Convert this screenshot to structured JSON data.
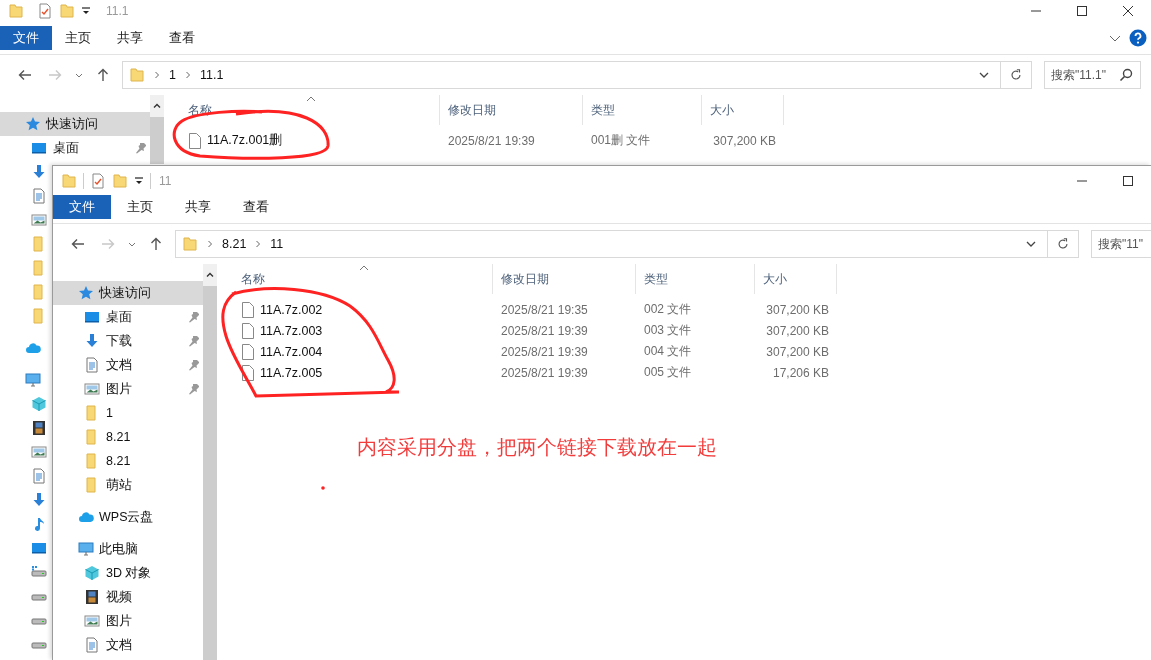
{
  "windows": [
    {
      "title": "11.1",
      "controls": [
        {
          "kind": "minimize"
        },
        {
          "kind": "maximize"
        },
        {
          "kind": "close"
        }
      ],
      "ribbon_tabs": [
        {
          "label": "文件",
          "selected": true
        },
        {
          "label": "主页",
          "selected": false
        },
        {
          "label": "共享",
          "selected": false
        },
        {
          "label": "查看",
          "selected": false
        }
      ],
      "ribbon_help": true,
      "forward_disabled": true,
      "address": [
        "1",
        "11.1"
      ],
      "search": {
        "placeholder": "搜索\"11.1\""
      },
      "sidebar": {
        "items": [
          {
            "kind": "quick",
            "label": "快速访问",
            "selected": true,
            "children": [
              {
                "kind": "desktop",
                "label": "桌面",
                "pinned": true,
                "selected": false
              },
              {
                "kind": "download",
                "selected": false
              },
              {
                "kind": "document",
                "selected": false
              },
              {
                "kind": "picture",
                "selected": false
              },
              {
                "kind": "folder",
                "selected": false
              },
              {
                "kind": "folder",
                "selected": false
              },
              {
                "kind": "folder",
                "selected": false
              },
              {
                "kind": "folder",
                "selected": false
              }
            ]
          },
          {
            "kind": "cloud",
            "selected": false
          },
          {
            "kind": "pc",
            "selected": false,
            "children": [
              {
                "kind": "cube",
                "selected": false
              },
              {
                "kind": "video",
                "selected": false
              },
              {
                "kind": "picture",
                "selected": false
              },
              {
                "kind": "document",
                "selected": false
              },
              {
                "kind": "download",
                "selected": false
              },
              {
                "kind": "music",
                "selected": false
              },
              {
                "kind": "desktop",
                "selected": false
              },
              {
                "kind": "drive-win",
                "selected": false
              },
              {
                "kind": "drive",
                "selected": false
              },
              {
                "kind": "drive",
                "selected": false
              },
              {
                "kind": "drive",
                "selected": false
              }
            ]
          }
        ]
      },
      "columns": [
        "名称",
        "修改日期",
        "类型",
        "大小"
      ],
      "rows": [
        {
          "name": "11A.7z.001删",
          "date": "2025/8/21 19:39",
          "type": "001删 文件",
          "size": "307,200 KB"
        }
      ]
    },
    {
      "title": "11",
      "controls": [
        {
          "kind": "minimize"
        },
        {
          "kind": "maximize"
        }
      ],
      "ribbon_tabs": [
        {
          "label": "文件",
          "selected": true
        },
        {
          "label": "主页",
          "selected": false
        },
        {
          "label": "共享",
          "selected": false
        },
        {
          "label": "查看",
          "selected": false
        }
      ],
      "forward_disabled": true,
      "address": [
        "8.21",
        "11"
      ],
      "search": {
        "placeholder": "搜索\"11\""
      },
      "sidebar": {
        "items": [
          {
            "kind": "quick",
            "label": "快速访问",
            "selected": true,
            "children": [
              {
                "kind": "desktop",
                "label": "桌面",
                "pinned": true,
                "selected": false
              },
              {
                "kind": "download",
                "label": "下载",
                "pinned": true,
                "selected": false
              },
              {
                "kind": "document",
                "label": "文档",
                "pinned": true,
                "selected": false
              },
              {
                "kind": "picture",
                "label": "图片",
                "pinned": true,
                "selected": false
              },
              {
                "kind": "folder",
                "label": "1",
                "pinned": false,
                "selected": false
              },
              {
                "kind": "folder",
                "label": "8.21",
                "pinned": false,
                "selected": false
              },
              {
                "kind": "folder",
                "label": "8.21",
                "pinned": false,
                "selected": false
              },
              {
                "kind": "folder",
                "label": "萌站",
                "pinned": false,
                "selected": false
              }
            ]
          },
          {
            "kind": "cloud",
            "label": "WPS云盘",
            "selected": false
          },
          {
            "kind": "pc",
            "label": "此电脑",
            "selected": false,
            "children": [
              {
                "kind": "cube",
                "label": "3D 对象",
                "selected": false
              },
              {
                "kind": "video",
                "label": "视频",
                "selected": false
              },
              {
                "kind": "picture",
                "label": "图片",
                "selected": false
              },
              {
                "kind": "document",
                "label": "文档",
                "selected": false
              }
            ]
          }
        ]
      },
      "columns": [
        "名称",
        "修改日期",
        "类型",
        "大小"
      ],
      "rows": [
        {
          "name": "11A.7z.002",
          "date": "2025/8/21 19:35",
          "type": "002 文件",
          "size": "307,200 KB"
        },
        {
          "name": "11A.7z.003",
          "date": "2025/8/21 19:39",
          "type": "003 文件",
          "size": "307,200 KB"
        },
        {
          "name": "11A.7z.004",
          "date": "2025/8/21 19:39",
          "type": "004 文件",
          "size": "307,200 KB"
        },
        {
          "name": "11A.7z.005",
          "date": "2025/8/21 19:39",
          "type": "005 文件",
          "size": "17,206 KB"
        }
      ]
    }
  ],
  "annotation": {
    "note": "内容采用分盘，把两个链接下载放在一起"
  }
}
